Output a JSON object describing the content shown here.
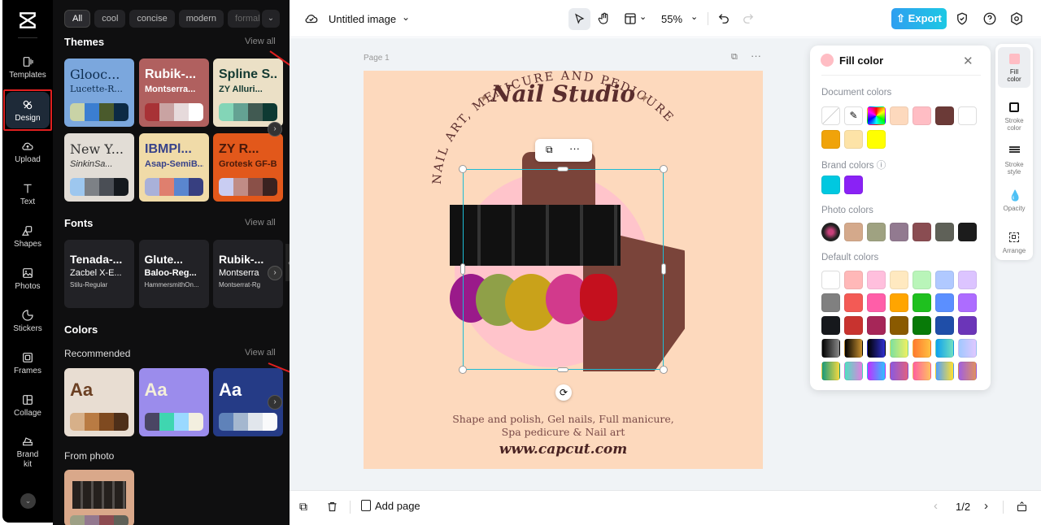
{
  "rail": {
    "items": [
      {
        "label": "Templates",
        "icon": "templates-icon"
      },
      {
        "label": "Design",
        "icon": "design-icon",
        "active": true
      },
      {
        "label": "Upload",
        "icon": "upload-icon"
      },
      {
        "label": "Text",
        "icon": "text-icon"
      },
      {
        "label": "Shapes",
        "icon": "shapes-icon"
      },
      {
        "label": "Photos",
        "icon": "photos-icon"
      },
      {
        "label": "Stickers",
        "icon": "stickers-icon"
      },
      {
        "label": "Frames",
        "icon": "frames-icon"
      },
      {
        "label": "Collage",
        "icon": "collage-icon"
      },
      {
        "label": "Brand\nkit",
        "icon": "brand-kit-icon"
      }
    ],
    "more": "⌄"
  },
  "panel": {
    "chips": [
      "All",
      "cool",
      "concise",
      "modern",
      "formal"
    ],
    "themes_title": "Themes",
    "view_all": "View all",
    "themes": [
      {
        "t1": "Glooc...",
        "t2": "Lucette-R...",
        "bg": "#7ba7dd",
        "fg": "#0f2f52",
        "palette": [
          "#c9d3a6",
          "#3b7ed1",
          "#4a5a2c",
          "#0c2a44"
        ]
      },
      {
        "t1": "Rubik-...",
        "t2": "Montserra...",
        "bg": "#b0605f",
        "fg": "#ffffff",
        "palette": [
          "#a83236",
          "#c9a3a2",
          "#e6dadb",
          "#ffffff"
        ]
      },
      {
        "t1": "Spline S...",
        "t2": "ZY Alluri...",
        "bg": "#ebe0c6",
        "fg": "#143a32",
        "palette": [
          "#83d5b7",
          "#64a293",
          "#415a52",
          "#0e3a33"
        ]
      },
      {
        "t1": "New Y...",
        "t2": "SinkinSa...",
        "bg": "#e2ddd6",
        "fg": "#333333",
        "palette": [
          "#9dc7ef",
          "#7d8186",
          "#4a4e55",
          "#15191e"
        ]
      },
      {
        "t1": "IBMPl...",
        "t2": "Asap-SemiB...",
        "bg": "#f0dba8",
        "fg": "#37428a",
        "palette": [
          "#a9b1d9",
          "#df7f6e",
          "#5a86cf",
          "#373f80"
        ]
      },
      {
        "t1": "ZY R...",
        "t2": "Grotesk GF-B...",
        "bg": "#e2581b",
        "fg": "#4a1a0a",
        "palette": [
          "#c9cdf2",
          "#c08c86",
          "#8a5048",
          "#3a2220"
        ]
      }
    ],
    "fonts_title": "Fonts",
    "fonts": [
      {
        "f1": "Tenada-...",
        "f2": "Zacbel X-E...",
        "f3": "Stilu-Regular"
      },
      {
        "f1": "Glute...",
        "f2": "Baloo-Reg...",
        "f3": "HammersmithOn..."
      },
      {
        "f1": "Rubik-...",
        "f2": "Montserra",
        "f3": "Montserrat-Rg"
      }
    ],
    "colors_title": "Colors",
    "recommended": "Recommended",
    "color_cards": [
      {
        "aa": "Aa",
        "bg": "#e8ddd2",
        "fg": "#6b3f22",
        "palette": [
          "#d7b089",
          "#b97b43",
          "#7f4a20",
          "#4e2f19"
        ]
      },
      {
        "aa": "Aa",
        "bg": "#9b8cec",
        "fg": "#f4efd9",
        "palette": [
          "#4a4563",
          "#3fd6b0",
          "#9ad9ff",
          "#f3efdf"
        ]
      },
      {
        "aa": "Aa",
        "bg": "#253b86",
        "fg": "#ffffff",
        "palette": [
          "#5f82b9",
          "#a4b7cf",
          "#e1e6ec",
          "#f9fafb"
        ]
      }
    ],
    "from_photo": "From photo",
    "photo_palette": [
      "#9da085",
      "#93788f",
      "#8d4b51",
      "#5f6158"
    ]
  },
  "topbar": {
    "title": "Untitled image",
    "zoom": "55%",
    "export": "Export"
  },
  "page": {
    "label": "Page 1",
    "title": "Nail Studio",
    "arc_text": "NAIL ART, MENICURE AND PEDICURE",
    "services_line1": "Shape and polish, Gel nails, Full manicure,",
    "services_line2": "Spa pedicure & Nail art",
    "url": "www.capcut.com"
  },
  "bottombar": {
    "add_page": "Add page",
    "pagination": "1/2"
  },
  "fill_panel": {
    "title": "Fill color",
    "current": "#ffbdc4",
    "document_colors_label": "Document colors",
    "document_colors": [
      "none",
      "eyedropper",
      "rainbow",
      "#fdd9bd",
      "#ffbdc4",
      "#6b3a37",
      "#ffffff",
      "#f0a30a",
      "#fde3a7",
      "#ffff00"
    ],
    "brand_colors_label": "Brand colors",
    "brand_colors": [
      "#00c8e0",
      "#8a22f5"
    ],
    "photo_colors_label": "Photo colors",
    "photo_colors": [
      "photo",
      "#d4a98b",
      "#9fa281",
      "#927a90",
      "#8a4d52",
      "#5f6158",
      "#1c1c1c"
    ],
    "default_colors_label": "Default colors",
    "default_colors": [
      "#ffffff",
      "#ffb8b8",
      "#ffbfdd",
      "#ffe9c0",
      "#b9f5b9",
      "#b0c9ff",
      "#dcc4ff",
      "#808080",
      "#f35a55",
      "#ff5ea8",
      "#ffa500",
      "#1fc01f",
      "#5b8fff",
      "#ad6cff",
      "#16181c",
      "#c8332f",
      "#a62658",
      "#8a5a00",
      "#087a08",
      "#1f4ea8",
      "#6b35b8",
      "linear-gradient(90deg,#000,#888)",
      "linear-gradient(90deg,#000,#c89030)",
      "linear-gradient(90deg,#000,#3030d0)",
      "linear-gradient(90deg,#7de0a0,#f0f060)",
      "linear-gradient(90deg,#ff7a30,#ffc040)",
      "linear-gradient(90deg,#0ea0ef,#70e0c0)",
      "linear-gradient(90deg,#a0c8ff,#e0c8ff)",
      "linear-gradient(90deg,#1a9a7a,#f5d940)",
      "linear-gradient(90deg,#50e0c0,#e080e0)",
      "linear-gradient(90deg,#c030ff,#30c0ff)",
      "linear-gradient(90deg,#8a5ae0,#e06080)",
      "linear-gradient(90deg,#ff60a0,#ffc060)",
      "linear-gradient(90deg,#50a0ff,#ffe030)",
      "linear-gradient(90deg,#a060e0,#e09060)"
    ]
  },
  "props": [
    {
      "label": "Fill\ncolor",
      "icon": "fill-color-icon"
    },
    {
      "label": "Stroke\ncolor",
      "icon": "stroke-color-icon"
    },
    {
      "label": "Stroke\nstyle",
      "icon": "stroke-style-icon"
    },
    {
      "label": "Opacity",
      "icon": "opacity-icon"
    },
    {
      "label": "Arrange",
      "icon": "arrange-icon"
    }
  ]
}
